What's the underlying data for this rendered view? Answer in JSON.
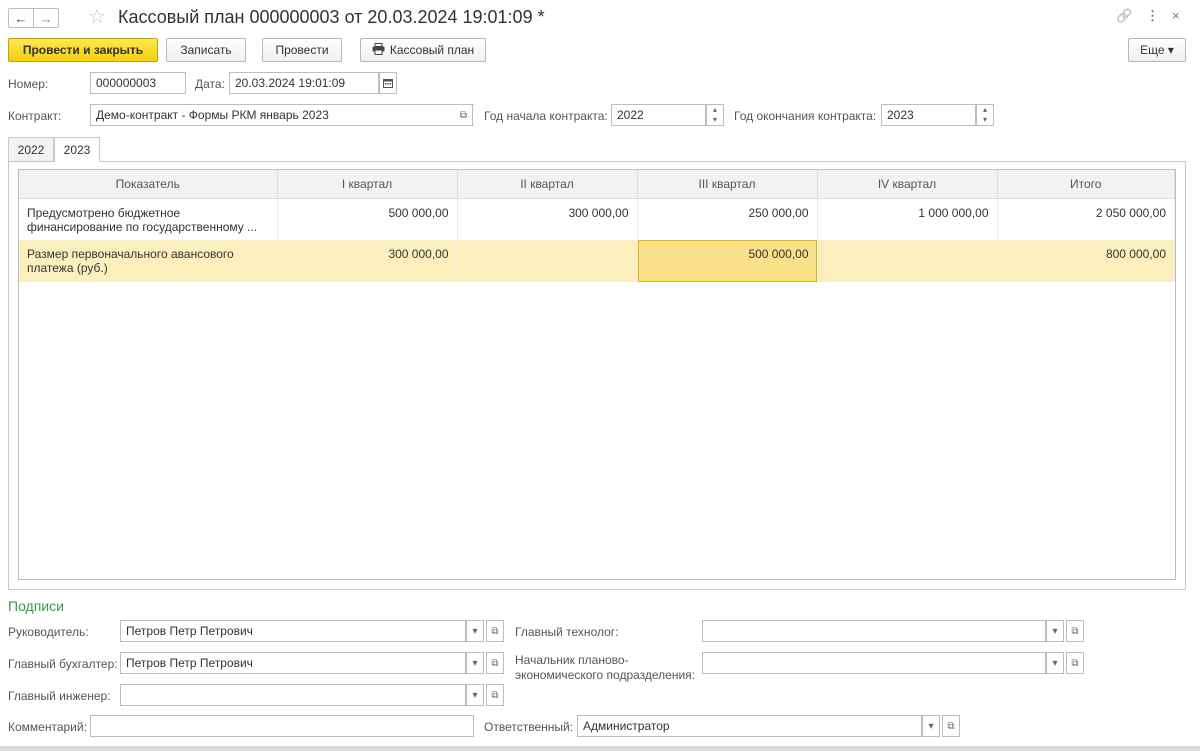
{
  "window": {
    "title": "Кассовый план 000000003 от 20.03.2024 19:01:09 *",
    "back": "←",
    "forward": "→",
    "star": "☆",
    "link": "🔗",
    "more": "⋮",
    "close": "×"
  },
  "toolbar": {
    "post_close": "Провести и закрыть",
    "save": "Записать",
    "post": "Провести",
    "print": "Кассовый план",
    "more": "Еще ▾"
  },
  "header": {
    "number_label": "Номер:",
    "number_value": "000000003",
    "date_label": "Дата:",
    "date_value": "20.03.2024 19:01:09",
    "contract_label": "Контракт:",
    "contract_value": "Демо-контракт - Формы РКМ январь 2023",
    "start_year_label": "Год начала контракта:",
    "start_year_value": "2022",
    "end_year_label": "Год окончания контракта:",
    "end_year_value": "2023"
  },
  "tabs": [
    "2022",
    "2023"
  ],
  "table": {
    "columns": [
      "Показатель",
      "I квартал",
      "II квартал",
      "III квартал",
      "IV квартал",
      "Итого"
    ],
    "rows": [
      {
        "indicator_line1": "Предусмотрено бюджетное",
        "indicator_line2": "финансирование по государственному ...",
        "q1": "500 000,00",
        "q2": "300 000,00",
        "q3": "250 000,00",
        "q4": "1 000 000,00",
        "total": "2 050 000,00"
      },
      {
        "indicator_line1": "Размер первоначального авансового",
        "indicator_line2": "платежа (руб.)",
        "q1": "300 000,00",
        "q2": "",
        "q3": "500 000,00",
        "q4": "",
        "total": "800 000,00"
      }
    ]
  },
  "signatures": {
    "section_title": "Подписи",
    "head_label": "Руководитель:",
    "head_value": "Петров Петр Петрович",
    "accountant_label": "Главный бухгалтер:",
    "accountant_value": "Петров Петр Петрович",
    "engineer_label": "Главный инженер:",
    "engineer_value": "",
    "technologist_label": "Главный технолог:",
    "technologist_value": "",
    "planning_head_label_line1": "Начальник планово-",
    "planning_head_label_line2": "экономического подразделения:",
    "planning_head_value": ""
  },
  "footer": {
    "comment_label": "Комментарий:",
    "comment_value": "",
    "responsible_label": "Ответственный:",
    "responsible_value": "Администратор"
  },
  "colors": {
    "accent_yellow": "#f4cf12",
    "selected_row": "#fbefbd",
    "section_green": "#3a9b46"
  }
}
